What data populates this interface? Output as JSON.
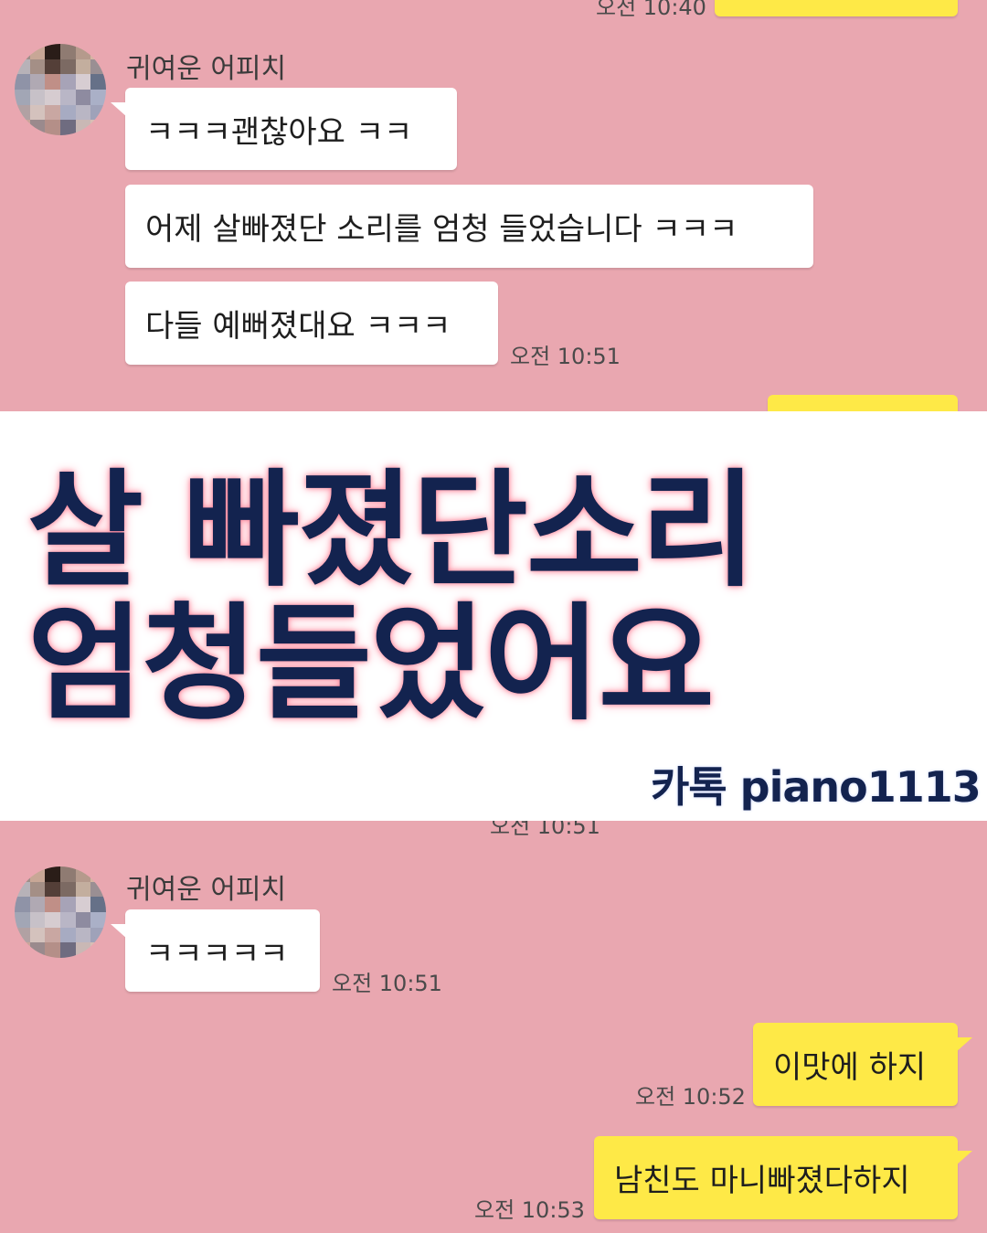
{
  "chat_top": {
    "partial_time": "오전 10:40",
    "sender_name": "귀여운 어피치",
    "messages": [
      "ㅋㅋㅋ괜찮아요 ㅋㅋ",
      "어제 살빠졌단 소리를 엄청 들었습니다 ㅋㅋㅋ",
      "다들 예뻐졌대요 ㅋㅋㅋ"
    ],
    "time": "오전 10:51"
  },
  "banner": {
    "headline_line1": "살 빠졌단소리",
    "headline_line2": "엄청들었어요",
    "watermark": "카톡 piano1113",
    "accent_color": "#13234f",
    "glow_color": "#ff7f95"
  },
  "chat_bottom": {
    "partial_time": "오전 10:51",
    "sender_name": "귀여운 어피치",
    "message": "ㅋㅋㅋㅋㅋ",
    "time": "오전 10:51",
    "my_messages": [
      {
        "text": "이맛에 하지",
        "time": "오전 10:52"
      },
      {
        "text": "남친도 마니빠졌다하지",
        "time": "오전 10:53"
      }
    ]
  },
  "colors": {
    "background": "#e9a7b0",
    "my_bubble": "#fee947",
    "their_bubble": "#ffffff"
  }
}
